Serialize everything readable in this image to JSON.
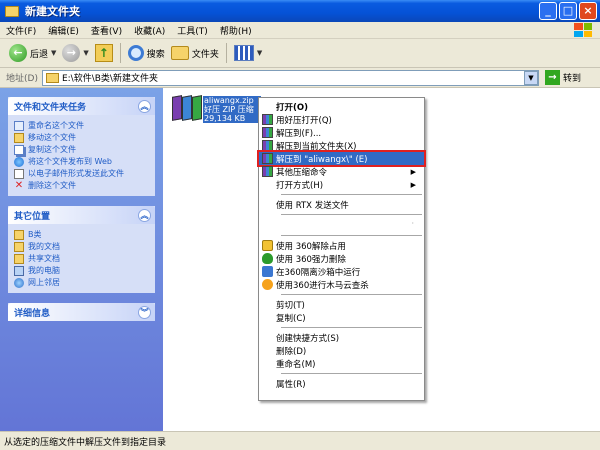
{
  "window": {
    "title": "新建文件夹",
    "buttons": [
      "_",
      "□",
      "×"
    ]
  },
  "menubar": [
    "文件(F)",
    "编辑(E)",
    "查看(V)",
    "收藏(A)",
    "工具(T)",
    "帮助(H)"
  ],
  "toolbar": {
    "back": "后退",
    "search": "搜索",
    "folders": "文件夹"
  },
  "address": {
    "label": "地址(D)",
    "path": "E:\\软件\\B类\\新建文件夹",
    "go": "转到"
  },
  "tasks": {
    "title": "文件和文件夹任务",
    "items": [
      "重命名这个文件",
      "移动这个文件",
      "复制这个文件",
      "将这个文件发布到 Web",
      "以电子邮件形式发送此文件",
      "删除这个文件"
    ]
  },
  "places": {
    "title": "其它位置",
    "items": [
      "B类",
      "我的文档",
      "共享文档",
      "我的电脑",
      "网上邻居"
    ]
  },
  "details": {
    "title": "详细信息"
  },
  "file": {
    "name": "aliwangx.zip",
    "type": "好压 ZIP 压缩",
    "size": "29,134 KB"
  },
  "context_menu": {
    "open": "打开(O)",
    "open_haozip": "用好压打开(Q)",
    "extract_to": "解压到(F)...",
    "extract_here": "解压到当前文件夹(X)",
    "extract_named": "解压到 \"aliwangx\\\" (E)",
    "other_cmds": "其他压缩命令",
    "open_with": "打开方式(H)",
    "send_rtx": "使用 RTX 发送文件",
    "unlock_360": "使用 360解除占用",
    "force_delete_360": "使用 360强力删除",
    "sandbox_360": "在360隔离沙箱中运行",
    "trojan_scan_360": "使用360进行木马云查杀",
    "cut": "剪切(T)",
    "copy": "复制(C)",
    "shortcut": "创建快捷方式(S)",
    "delete": "删除(D)",
    "rename": "重命名(M)",
    "properties": "属性(R)"
  },
  "status": "从选定的压缩文件中解压文件到指定目录"
}
